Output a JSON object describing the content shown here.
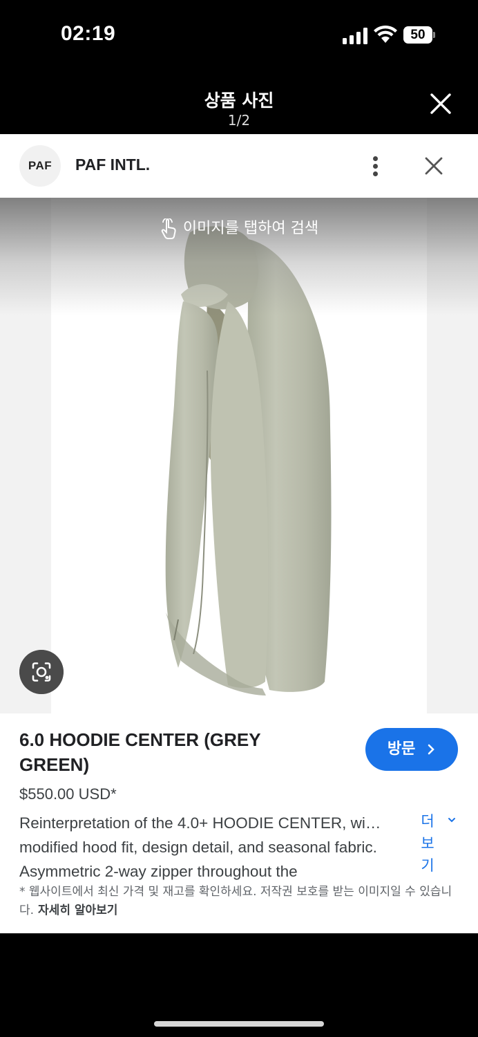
{
  "status_bar": {
    "time": "02:19",
    "battery": "50"
  },
  "viewer": {
    "title": "상품 사진",
    "counter": "1/2"
  },
  "source": {
    "logo_text": "PAF",
    "name": "PAF INTL."
  },
  "image": {
    "tap_hint": "이미지를 탭하여 검색",
    "lens_icon": "lens-icon"
  },
  "product": {
    "title": "6.0 HOODIE CENTER (GREY GREEN)",
    "price": "$550.00 USD*",
    "description": "Reinterpretation of the 4.0+ HOODIE CENTER, wi… modified hood fit, design detail, and seasonal fabric. Asymmetric 2-way zipper throughout the",
    "more_label": "더 보기",
    "visit_label": "방문",
    "disclaimer": "* 웹사이트에서 최신 가격 및 재고를 확인하세요. 저작권 보호를 받는 이미지일 수 있습니다.",
    "learn_more": "자세히 알아보기"
  },
  "colors": {
    "accent": "#1a73e8",
    "garment": "#b9bcab",
    "background": "#000000"
  }
}
